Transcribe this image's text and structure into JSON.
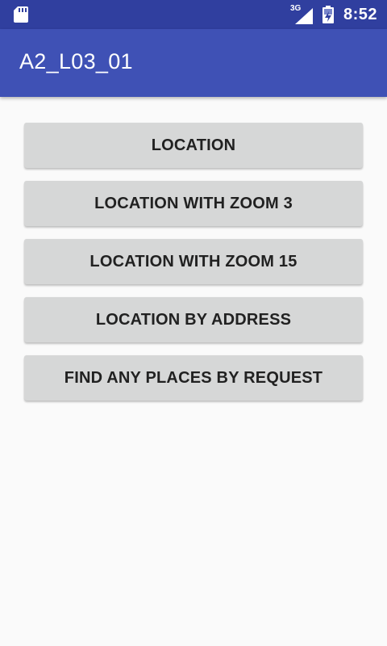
{
  "status_bar": {
    "network_label": "3G",
    "time": "8:52",
    "icons": [
      "sd-card-icon",
      "cell-signal-icon",
      "battery-charging-icon"
    ]
  },
  "app_bar": {
    "title": "A2_L03_01"
  },
  "buttons": [
    {
      "label": "LOCATION"
    },
    {
      "label": "LOCATION WITH ZOOM 3"
    },
    {
      "label": "LOCATION WITH ZOOM 15"
    },
    {
      "label": "LOCATION BY ADDRESS"
    },
    {
      "label": "FIND ANY PLACES BY REQUEST"
    }
  ],
  "colors": {
    "status_bar": "#303f9f",
    "app_bar": "#3f51b5",
    "background": "#fafafa",
    "button": "#d6d7d7",
    "button_text": "#212121"
  }
}
